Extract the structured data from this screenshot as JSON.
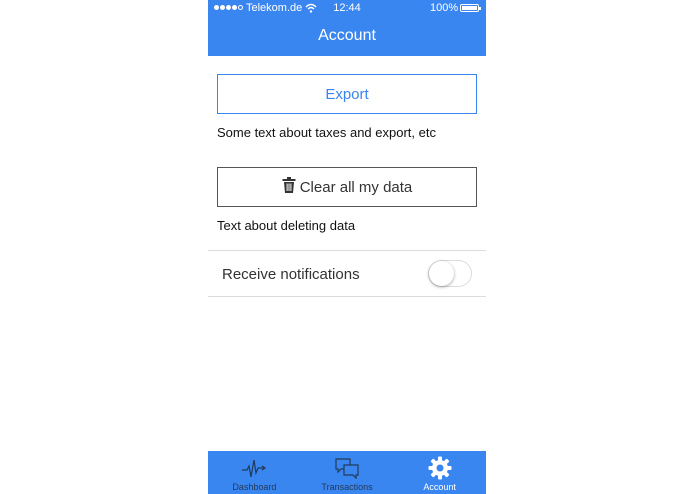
{
  "status_bar": {
    "carrier": "Telekom.de",
    "time": "12:44",
    "battery": "100%"
  },
  "header": {
    "title": "Account"
  },
  "export": {
    "button_label": "Export",
    "description": "Some text about taxes and export, etc"
  },
  "clear_data": {
    "button_label": "Clear all my data",
    "icon": "trash-icon",
    "description": "Text about deleting data"
  },
  "settings": {
    "notifications_label": "Receive notifications",
    "notifications_enabled": false
  },
  "tab_bar": {
    "tabs": [
      {
        "label": "Dashboard",
        "icon": "pulse-icon",
        "active": false
      },
      {
        "label": "Transactions",
        "icon": "chat-bubbles-icon",
        "active": false
      },
      {
        "label": "Account",
        "icon": "gear-icon",
        "active": true
      }
    ]
  },
  "colors": {
    "accent": "#3a86f0",
    "tab_inactive": "#233a5a"
  }
}
